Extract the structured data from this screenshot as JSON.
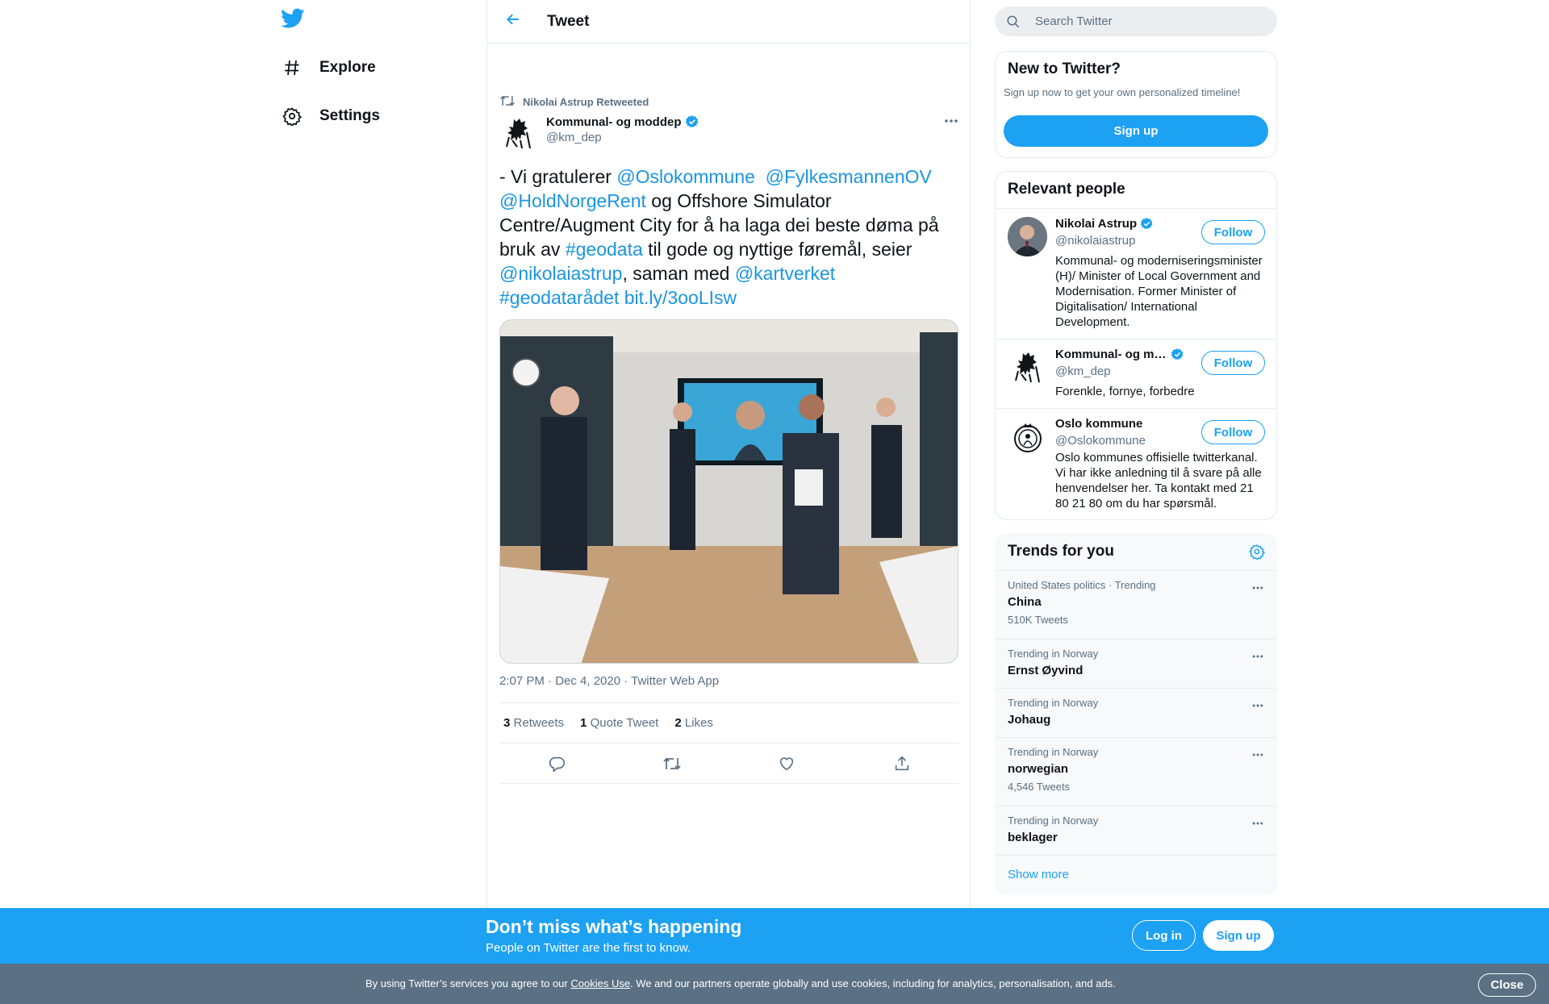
{
  "colors": {
    "brand": "#1da1f2",
    "link": "#1b95e0",
    "text": "#0f1419",
    "muted": "#5b7083",
    "cookie_bg": "#5b7083"
  },
  "nav": {
    "logo_icon": "twitter-bird-icon",
    "items": [
      {
        "label": "Explore",
        "icon": "hashtag-icon"
      },
      {
        "label": "Settings",
        "icon": "gear-icon"
      }
    ]
  },
  "header": {
    "title": "Tweet",
    "back_icon": "arrow-left-icon"
  },
  "tweet": {
    "retweeted_by": "Nikolai Astrup Retweeted",
    "author_name": "Kommunal- og moddep",
    "author_handle": "@km_dep",
    "text_parts": {
      "p1": "- Vi gratulerer ",
      "m1": "@Oslokommune",
      "p2": "  ",
      "m2": "@FylkesmannenOV",
      "m3": "@HoldNorgeRent",
      "p3": " og Offshore Simulator Centre/Augment City for å ha laga dei beste døma på bruk av ",
      "h1": "#geodata",
      "p4": " til gode og nyttige føremål, seier ",
      "m4": "@nikolaiastrup",
      "p5": ", saman med ",
      "m5": "@kartverket",
      "h2": "#geodatarådet",
      "u1": "bit.ly/3ooLIsw"
    },
    "meta": "2:07 PM · Dec 4, 2020 · Twitter Web App",
    "stats": {
      "retweets_count": "3",
      "retweets_label": "Retweets",
      "quotes_count": "1",
      "quotes_label": "Quote Tweet",
      "likes_count": "2",
      "likes_label": "Likes"
    }
  },
  "search": {
    "placeholder": "Search Twitter"
  },
  "new_to_twitter": {
    "title": "New to Twitter?",
    "subtitle": "Sign up now to get your own personalized timeline!",
    "button": "Sign up"
  },
  "relevant": {
    "title": "Relevant people",
    "people": [
      {
        "name": "Nikolai Astrup",
        "handle": "@nikolaiastrup",
        "bio": "Kommunal- og moderniseringsminister (H)/ Minister of Local Government and Modernisation. Former Minister of Digitalisation/ International Development.",
        "follow": "Follow"
      },
      {
        "name": "Kommunal- og mo…",
        "handle": "@km_dep",
        "bio": "Forenkle, fornye, forbedre",
        "follow": "Follow"
      },
      {
        "name": "Oslo kommune",
        "handle": "@Oslokommune",
        "bio": "Oslo kommunes offisielle twitterkanal. Vi har ikke anledning til å svare på alle henvendelser her. Ta kontakt med 21 80 21 80 om du har spørsmål.",
        "follow": "Follow"
      }
    ]
  },
  "trends": {
    "title": "Trends for you",
    "items": [
      {
        "category": "United States politics · Trending",
        "name": "China",
        "count": "510K Tweets"
      },
      {
        "category": "Trending in Norway",
        "name": "Ernst Øyvind",
        "count": ""
      },
      {
        "category": "Trending in Norway",
        "name": "Johaug",
        "count": ""
      },
      {
        "category": "Trending in Norway",
        "name": "norwegian",
        "count": "4,546 Tweets"
      },
      {
        "category": "Trending in Norway",
        "name": "beklager",
        "count": ""
      }
    ],
    "show_more": "Show more"
  },
  "signup_bar": {
    "title": "Don’t miss what’s happening",
    "subtitle": "People on Twitter are the first to know.",
    "login": "Log in",
    "signup": "Sign up"
  },
  "cookie": {
    "pre": "By using Twitter’s services you agree to our ",
    "link": "Cookies Use",
    "post": ". We and our partners operate globally and use cookies, including for analytics, personalisation, and ads.",
    "close": "Close"
  }
}
